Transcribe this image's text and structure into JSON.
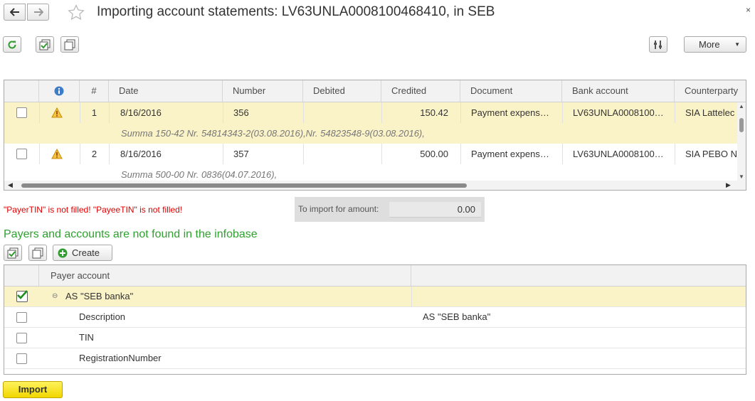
{
  "window": {
    "title": "Importing account statements: LV63UNLA0008100468410, in SEB",
    "close_glyph": "×"
  },
  "toolbar": {
    "more_label": "More"
  },
  "statements": {
    "columns": [
      "#",
      "Date",
      "Number",
      "Debited",
      "Credited",
      "Document",
      "Bank account",
      "Counterparty"
    ],
    "rows": [
      {
        "num": "1",
        "date": "8/16/2016",
        "number": "356",
        "debited": "",
        "credited": "150.42",
        "document": "Payment expens…",
        "bank_account": "LV63UNLA0008100…",
        "counterparty": "SIA Lattelec",
        "purpose": "Summa 150-42 Nr. 54814343-2(03.08.2016),Nr. 54823548-9(03.08.2016),"
      },
      {
        "num": "2",
        "date": "8/16/2016",
        "number": "357",
        "debited": "",
        "credited": "500.00",
        "document": "Payment expens…",
        "bank_account": "LV63UNLA0008100…",
        "counterparty": "SIA PEBO N",
        "purpose": "Summa 500-00 Nr. 0836(04.07.2016),"
      }
    ]
  },
  "error_message": "\"PayerTIN\" is not filled! \"PayeeTIN\" is not filled!",
  "import_sum": {
    "label": "To import for amount:",
    "value": "0.00"
  },
  "payers": {
    "title": "Payers and accounts are not found in the infobase",
    "create_label": "Create",
    "column_payer_account": "Payer account",
    "group": {
      "label": "AS \"SEB banka\"",
      "checked": true
    },
    "items": [
      {
        "label": "Description",
        "value": "AS \"SEB banka\""
      },
      {
        "label": "TIN",
        "value": ""
      },
      {
        "label": "RegistrationNumber",
        "value": ""
      }
    ]
  },
  "import_button": "Import",
  "colors": {
    "selected_row": "#fbf3c8",
    "section_title": "#2fa12f",
    "error": "#e00000",
    "import_button": "#f5dc00"
  }
}
